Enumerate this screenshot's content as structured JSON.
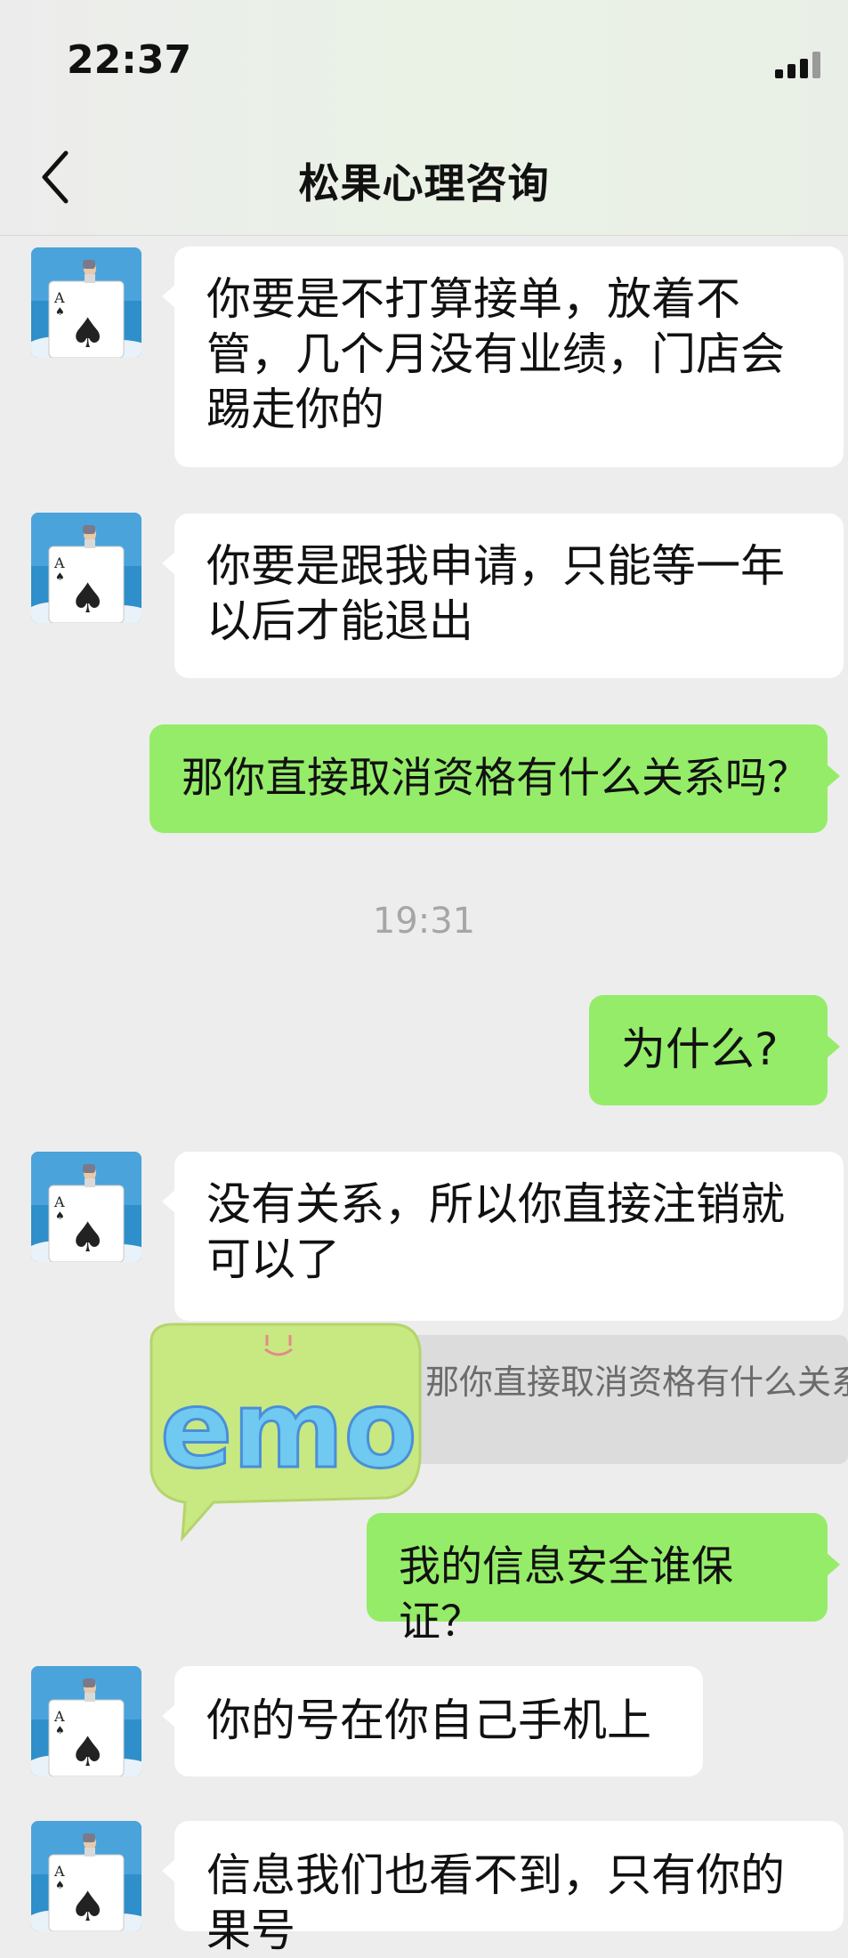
{
  "status_bar": {
    "time": "22:37"
  },
  "nav": {
    "title": "松果心理咨询"
  },
  "messages": {
    "m1": "你要是不打算接单，放着不管，几个月没有业绩，门店会踢走你的",
    "m2": "你要是跟我申请，只能等一年以后才能退出",
    "m3": "那你直接取消资格有什么关系吗？",
    "timestamp": "19:31",
    "m4": "为什么?",
    "m5": "没有关系，所以你直接注销就可以了",
    "sticker_text": "emo",
    "quote": "那你直接取消资格有什么关系吗？",
    "m6": "我的信息安全谁保证？",
    "m7": "你的号在你自己手机上",
    "m8": "信息我们也看不到，只有你的果号"
  },
  "colors": {
    "self_bubble": "#95ec69",
    "other_bubble": "#ffffff",
    "background": "#ededed"
  }
}
